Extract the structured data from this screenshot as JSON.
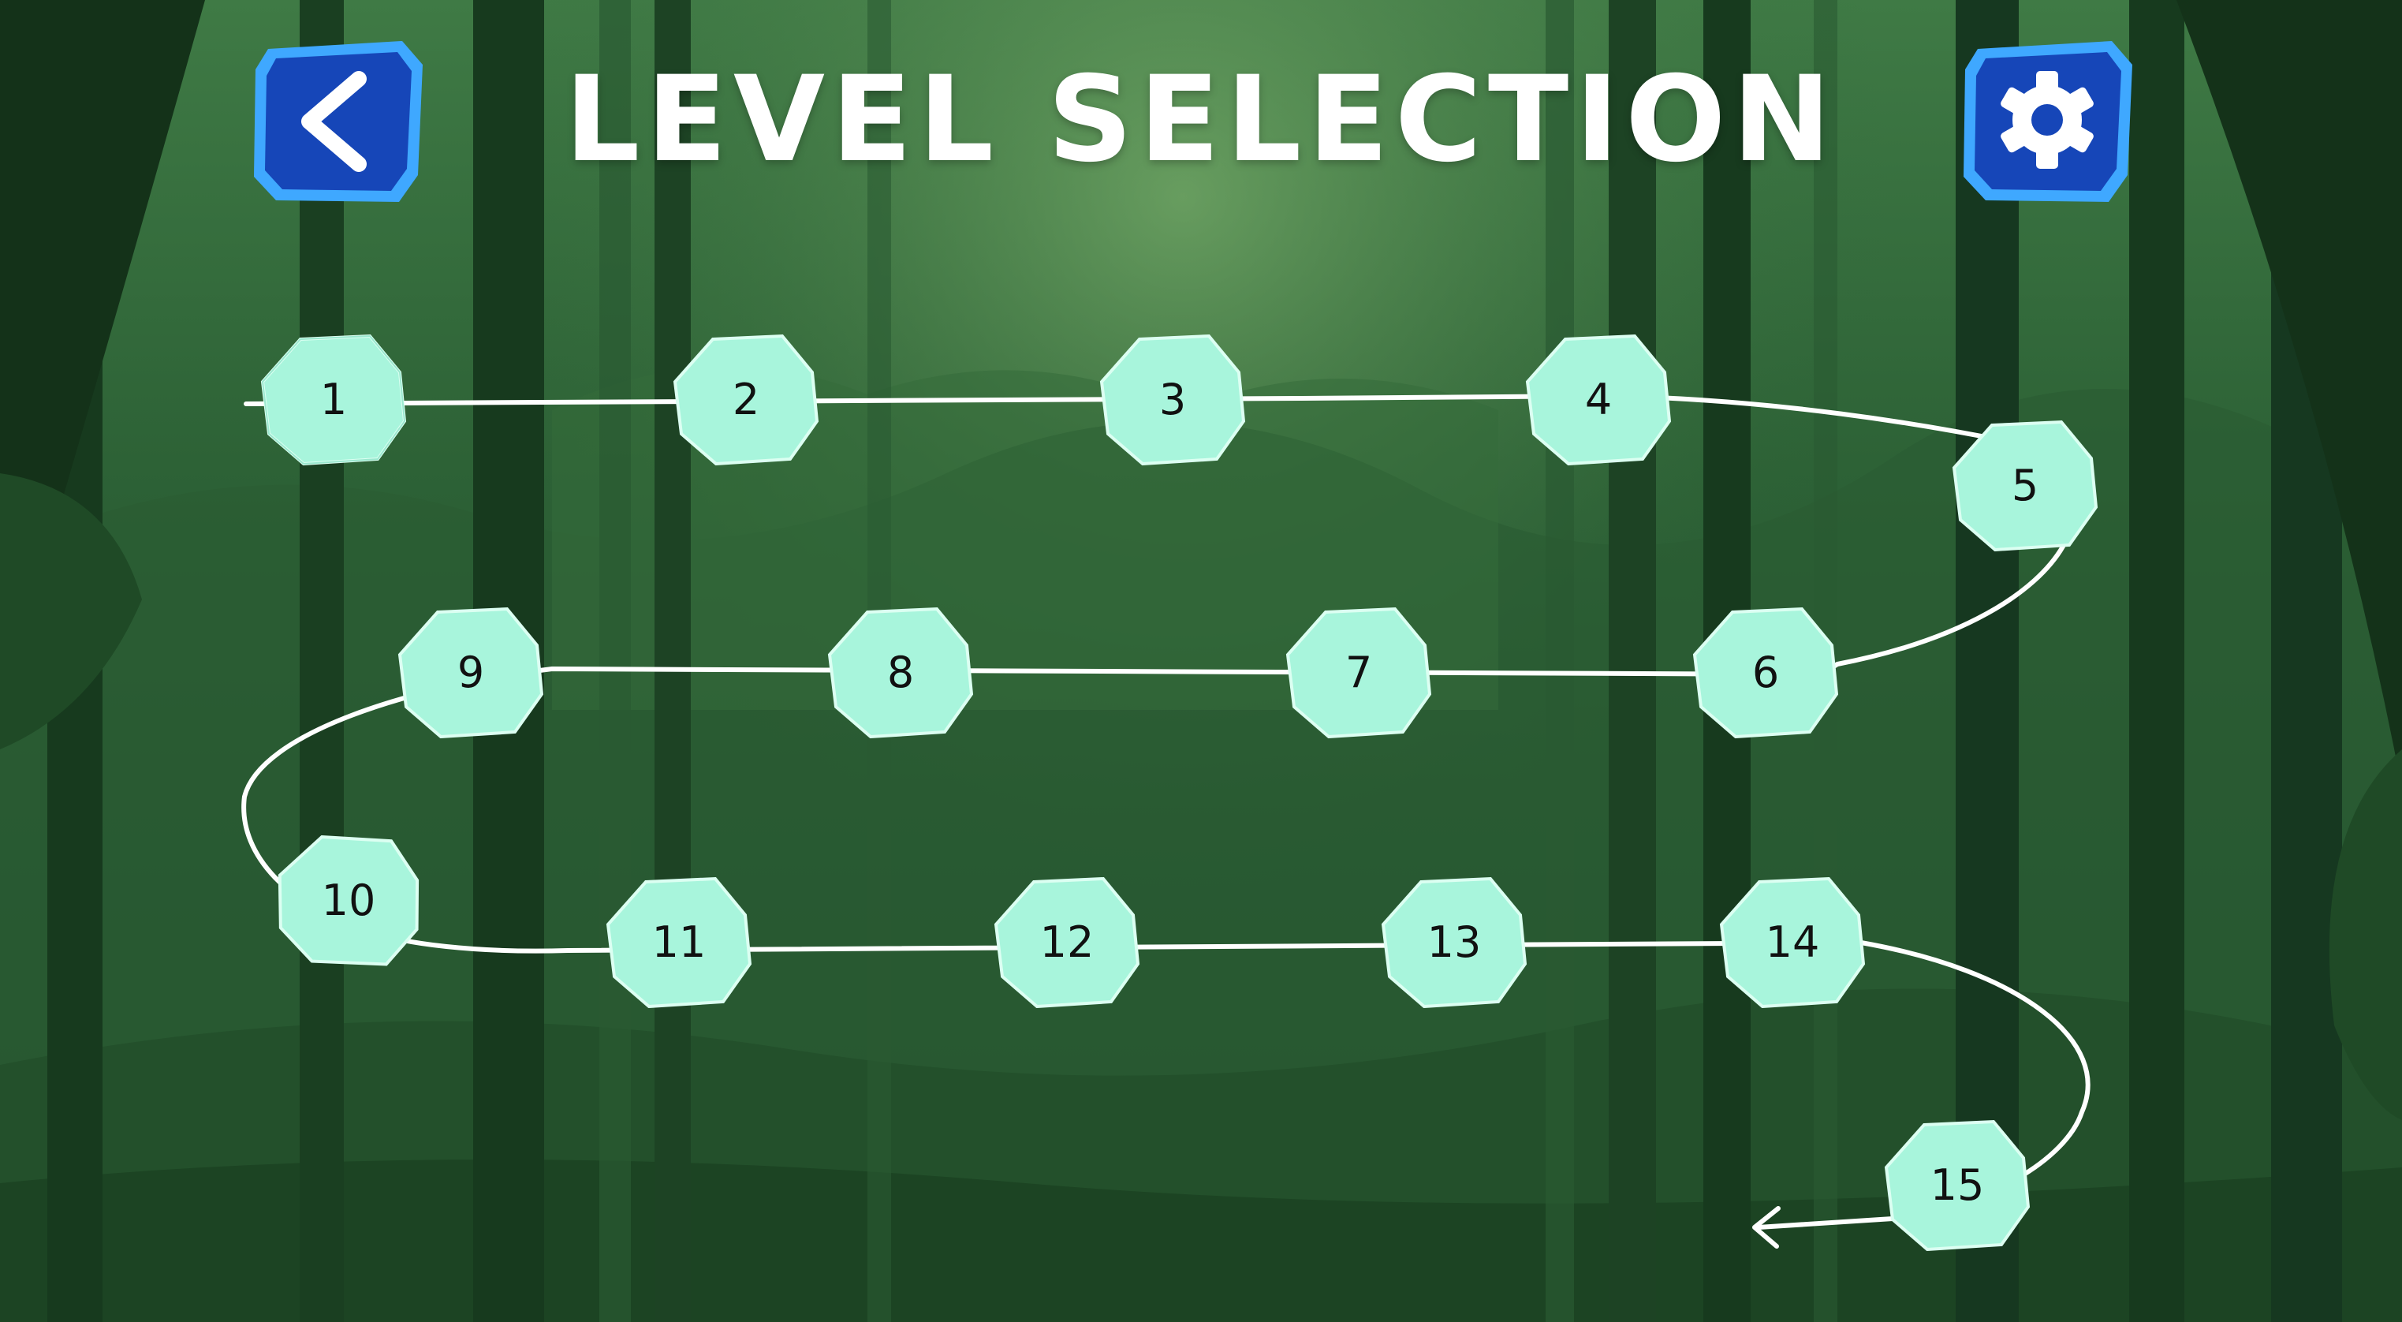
{
  "title": "LEVEL SELECTION",
  "header": {
    "back_icon": "chevron-left-icon",
    "settings_icon": "gear-icon"
  },
  "levels": [
    "1",
    "2",
    "3",
    "4",
    "5",
    "6",
    "7",
    "8",
    "9",
    "10",
    "11",
    "12",
    "13",
    "14",
    "15"
  ],
  "colors": {
    "button_blue": "#1646b8",
    "button_border": "#3fa8ff",
    "level_fill": "#a8f5dc",
    "path_line": "#ffffff"
  }
}
